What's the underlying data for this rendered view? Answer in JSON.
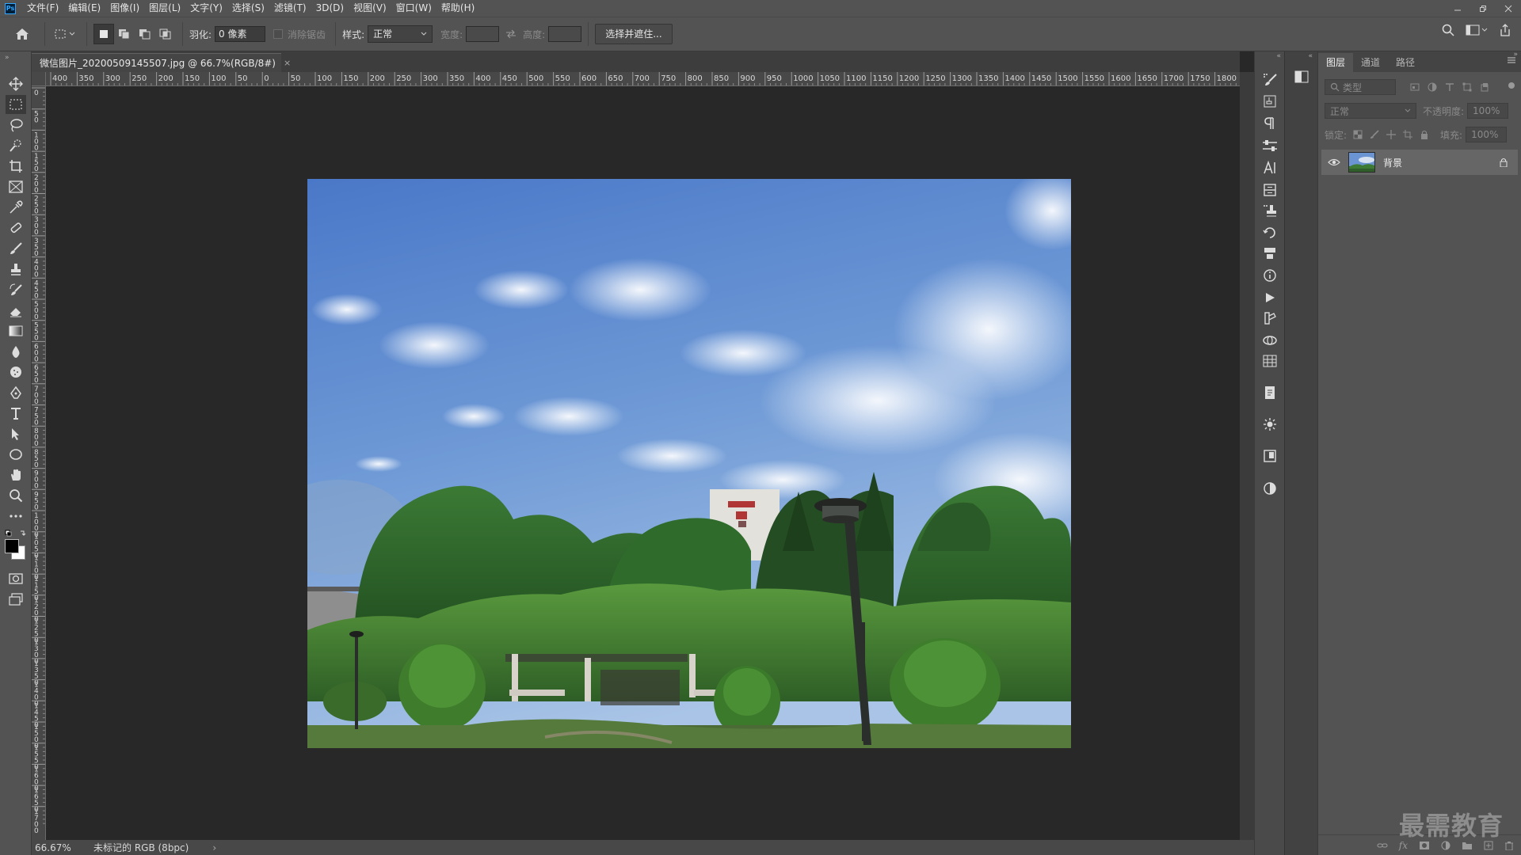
{
  "app": {
    "logo": "Ps",
    "menus": [
      "文件(F)",
      "编辑(E)",
      "图像(I)",
      "图层(L)",
      "文字(Y)",
      "选择(S)",
      "滤镜(T)",
      "3D(D)",
      "视图(V)",
      "窗口(W)",
      "帮助(H)"
    ]
  },
  "options": {
    "feather_label": "羽化:",
    "feather_value": "0 像素",
    "antialias_label": "消除锯齿",
    "style_label": "样式:",
    "style_value": "正常",
    "width_label": "宽度:",
    "height_label": "高度:",
    "select_mask_button": "选择并遮住..."
  },
  "document": {
    "tab_title": "微信图片_20200509145507.jpg @ 66.7%(RGB/8#)",
    "close": "×"
  },
  "rulers": {
    "h_ticks": [
      "400",
      "350",
      "300",
      "250",
      "200",
      "150",
      "100",
      "50",
      "0",
      "50",
      "100",
      "150",
      "200",
      "250",
      "300",
      "350",
      "400",
      "450",
      "500",
      "550",
      "600",
      "650",
      "700",
      "750",
      "800",
      "850",
      "900",
      "950",
      "1000",
      "1050",
      "1100",
      "1150",
      "1200",
      "1250",
      "1300",
      "1350",
      "1400",
      "1450",
      "1500",
      "1550",
      "1600",
      "1650",
      "1700",
      "1750",
      "1800"
    ],
    "v_ticks": [
      "0",
      "50",
      "100",
      "150",
      "200",
      "250",
      "300",
      "350",
      "400",
      "450",
      "500",
      "550",
      "600",
      "650",
      "700",
      "750",
      "800",
      "850",
      "900",
      "950",
      "1000",
      "1050",
      "1100",
      "1150",
      "1200",
      "1250",
      "1300",
      "1350",
      "1400",
      "1450",
      "1500",
      "1550",
      "1600",
      "1650",
      "1700"
    ]
  },
  "status": {
    "zoom": "66.67%",
    "profile": "未标记的 RGB (8bpc)",
    "arrow": "›"
  },
  "layers_panel": {
    "tabs": [
      "图层",
      "通道",
      "路径"
    ],
    "filter_placeholder": "类型",
    "blend_mode": "正常",
    "opacity_label": "不透明度:",
    "opacity_value": "100%",
    "lock_label": "锁定:",
    "fill_label": "填充:",
    "fill_value": "100%",
    "layer_name": "背景"
  },
  "watermark": "最需教育",
  "colors": {
    "ui_bg": "#535353",
    "canvas_bg": "#282828",
    "accent": "#31a8ff"
  }
}
